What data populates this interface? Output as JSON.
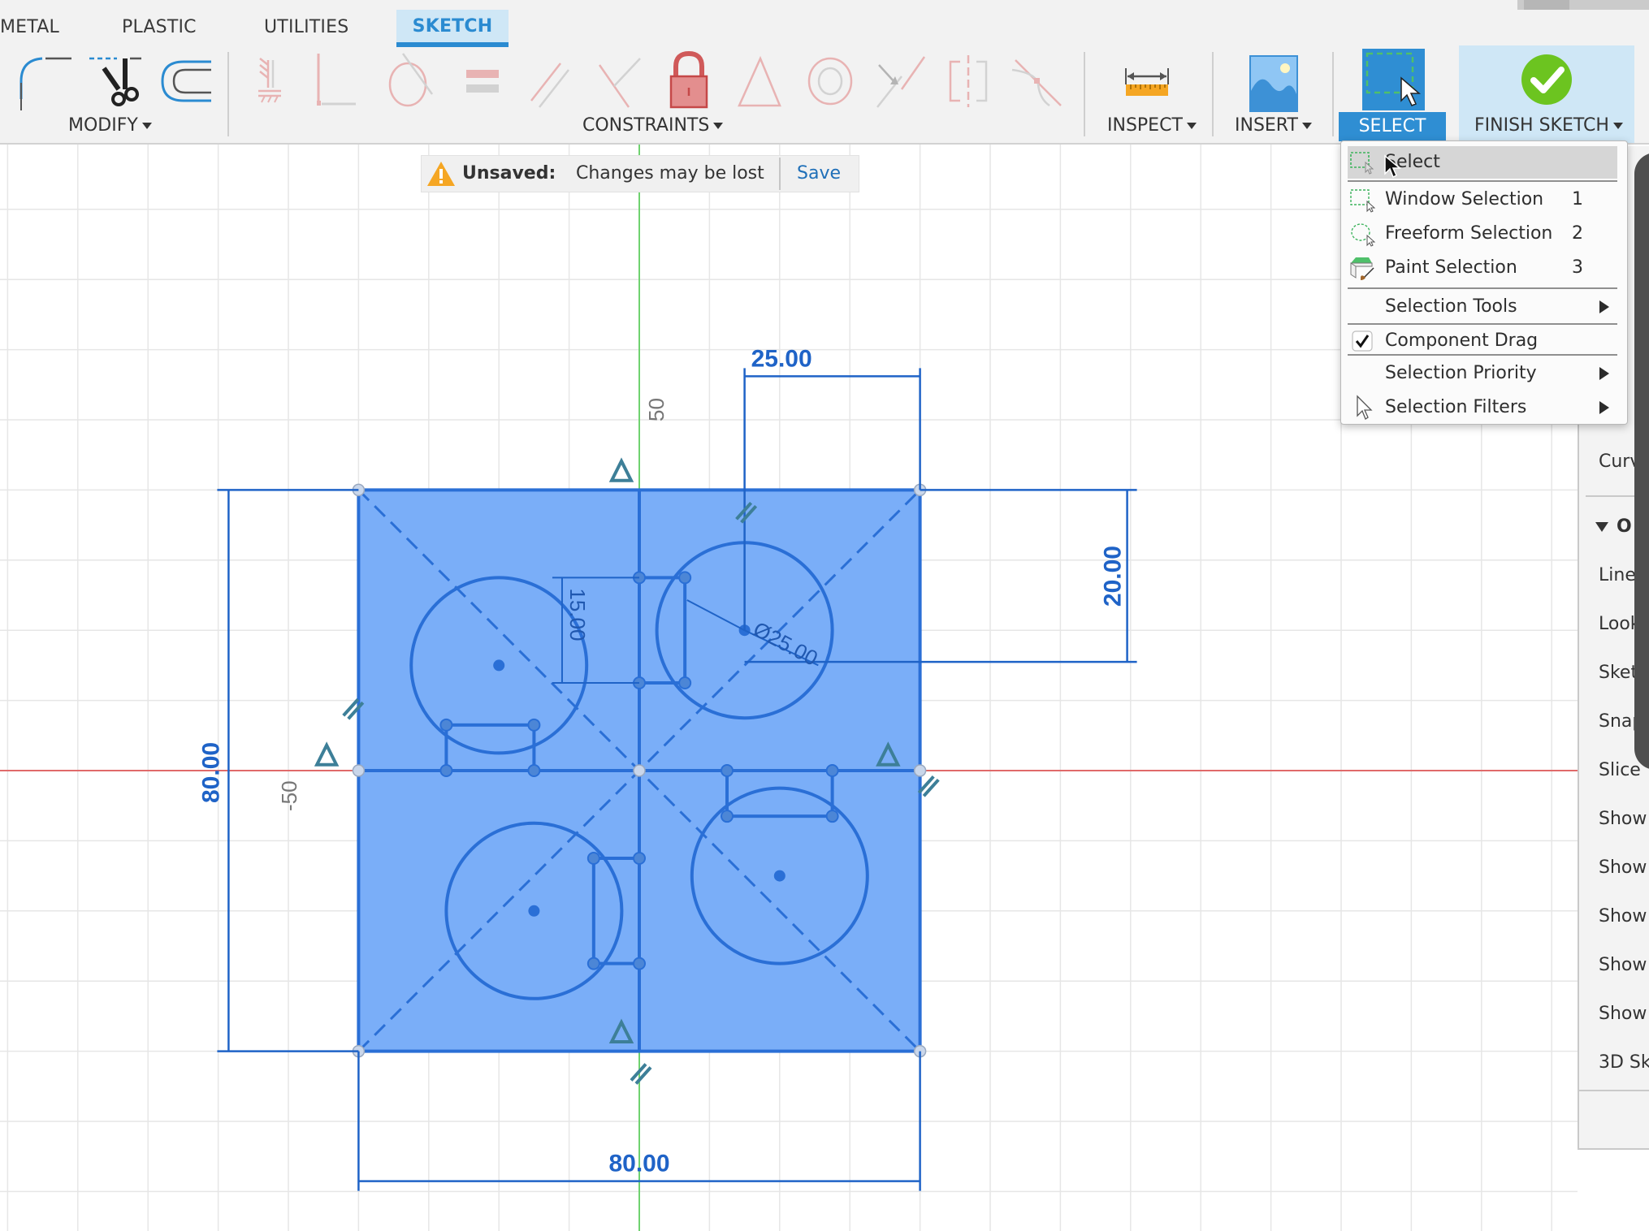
{
  "tabs": [
    {
      "label": "METAL",
      "active": false
    },
    {
      "label": "PLASTIC",
      "active": false
    },
    {
      "label": "UTILITIES",
      "active": false
    },
    {
      "label": "SKETCH",
      "active": true
    }
  ],
  "toolbar": {
    "modify": {
      "label": "MODIFY",
      "icons": [
        "fillet-icon",
        "trim-icon",
        "offset-icon"
      ]
    },
    "constraints": {
      "label": "CONSTRAINTS",
      "icons": [
        "coincident-icon",
        "collinear-icon",
        "tangent-icon",
        "equal-icon",
        "parallel-icon",
        "perpendicular-icon",
        "fix-lock-icon",
        "midpoint-icon",
        "concentric-icon",
        "horizontal-vertical-icon",
        "symmetry-icon",
        "curvature-icon"
      ]
    },
    "inspect": {
      "label": "INSPECT"
    },
    "insert": {
      "label": "INSERT"
    },
    "select": {
      "label": "SELECT",
      "active": true
    },
    "finish_sketch": {
      "label": "FINISH SKETCH"
    }
  },
  "banner": {
    "title": "Unsaved:",
    "message": "Changes may be lost",
    "save_label": "Save"
  },
  "select_menu": {
    "items": [
      {
        "label": "Select",
        "shortcut": "",
        "icon": "select-box-icon",
        "highlighted": true,
        "submenu": false
      },
      {
        "label": "Window Selection",
        "shortcut": "1",
        "icon": "window-selection-icon",
        "highlighted": false,
        "submenu": false
      },
      {
        "label": "Freeform Selection",
        "shortcut": "2",
        "icon": "freeform-selection-icon",
        "highlighted": false,
        "submenu": false
      },
      {
        "label": "Paint Selection",
        "shortcut": "3",
        "icon": "paint-selection-icon",
        "highlighted": false,
        "submenu": false
      },
      {
        "label": "Selection Tools",
        "shortcut": "",
        "icon": "",
        "highlighted": false,
        "submenu": true
      },
      {
        "label": "Component Drag",
        "shortcut": "",
        "icon": "checkbox-checked-icon",
        "checked": true,
        "highlighted": false,
        "submenu": false
      },
      {
        "label": "Selection Priority",
        "shortcut": "",
        "icon": "",
        "highlighted": false,
        "submenu": true
      },
      {
        "label": "Selection Filters",
        "shortcut": "",
        "icon": "cursor-arrow-icon",
        "highlighted": false,
        "submenu": true
      }
    ]
  },
  "right_panel": {
    "items": [
      "Curv",
      "O",
      "Line",
      "Look",
      "Sket",
      "Snap",
      "Slice",
      "Show",
      "Show",
      "Show",
      "Show",
      "Show",
      "3D Sk"
    ]
  },
  "sketch": {
    "dimensions": {
      "width": "80.00",
      "height": "80.00",
      "top_offset": "25.00",
      "right_offset": "20.00",
      "slot_height": "15.00",
      "circle_diameter": "Ø25.00"
    },
    "axis_labels": {
      "y_positive": "50",
      "x_negative": "-50"
    },
    "colors": {
      "profile_fill": "#7aaef8",
      "sketch_line": "#2a6fd6",
      "x_axis": "#e06a6a",
      "y_axis": "#6fd26f",
      "grid": "#e6e6e6"
    }
  }
}
